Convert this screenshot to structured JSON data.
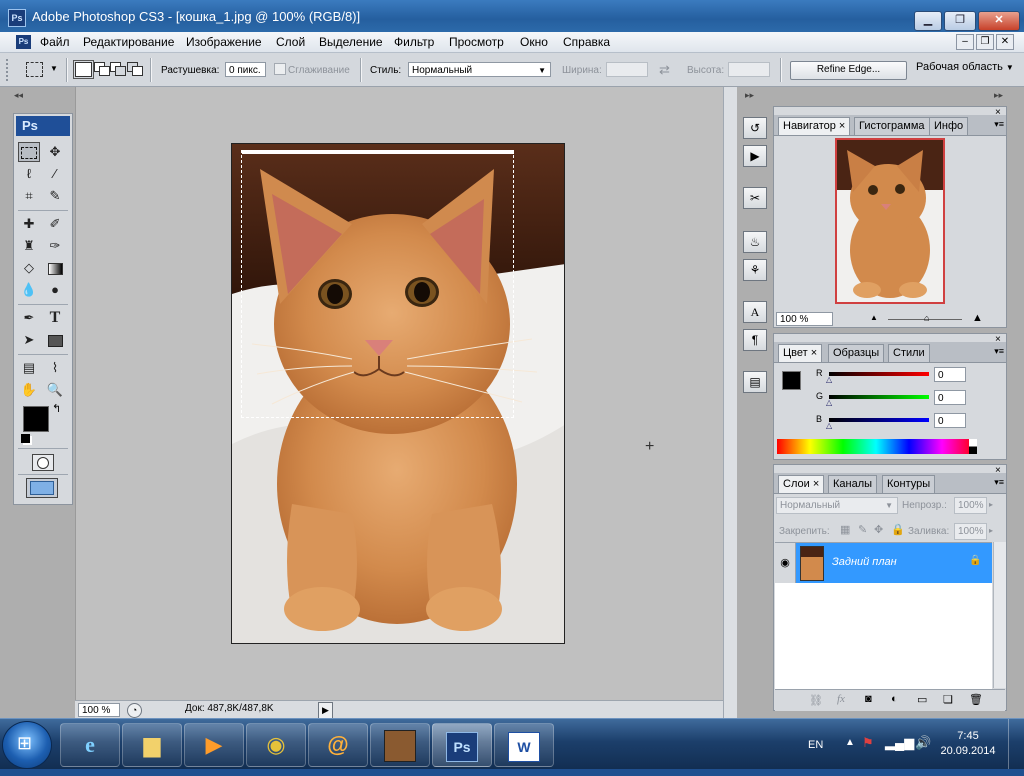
{
  "window": {
    "title": "Adobe Photoshop CS3 - [кошка_1.jpg @ 100% (RGB/8)]",
    "app_icon": "Ps"
  },
  "menu": [
    "Файл",
    "Редактирование",
    "Изображение",
    "Слой",
    "Выделение",
    "Фильтр",
    "Просмотр",
    "Окно",
    "Справка"
  ],
  "options": {
    "feather_label": "Растушевка:",
    "feather_value": "0 пикс.",
    "antialias_label": "Сглаживание",
    "style_label": "Стиль:",
    "style_value": "Нормальный",
    "width_label": "Ширина:",
    "height_label": "Высота:",
    "refine_edge": "Refine Edge...",
    "workspace": "Рабочая область"
  },
  "toolbox": {
    "header": "Ps"
  },
  "status": {
    "zoom": "100 %",
    "doc_info": "Док: 487,8K/487,8K"
  },
  "navigator": {
    "tabs": [
      "Навигатор",
      "Гистограмма",
      "Инфо"
    ],
    "zoom": "100 %"
  },
  "color_panel": {
    "tabs": [
      "Цвет",
      "Образцы",
      "Стили"
    ],
    "channels": [
      {
        "label": "R",
        "value": "0"
      },
      {
        "label": "G",
        "value": "0"
      },
      {
        "label": "B",
        "value": "0"
      }
    ]
  },
  "layers_panel": {
    "tabs": [
      "Слои",
      "Каналы",
      "Контуры"
    ],
    "blend_mode": "Нормальный",
    "opacity_label": "Непрозр.:",
    "opacity_value": "100%",
    "lock_label": "Закрепить:",
    "fill_label": "Заливка:",
    "fill_value": "100%",
    "layer_name": "Задний план"
  },
  "taskbar": {
    "language": "EN",
    "time": "7:45",
    "date": "20.09.2014"
  },
  "colors": {
    "selected_layer": "#3399ff",
    "nav_frame": "#d04040"
  }
}
